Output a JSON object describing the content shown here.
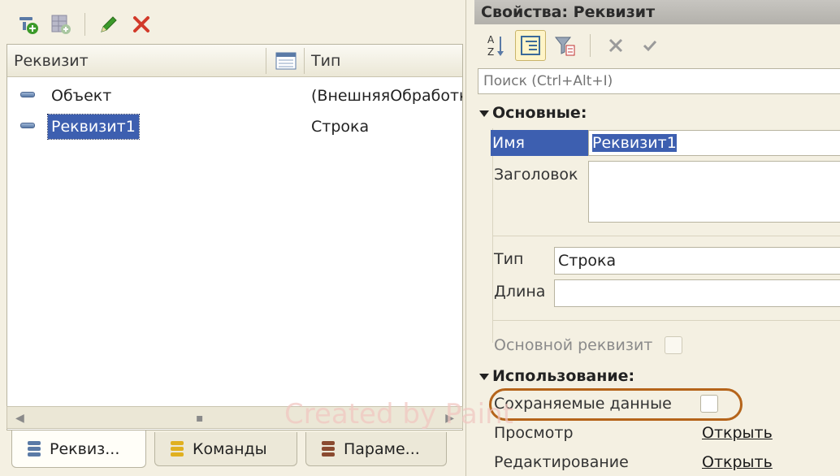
{
  "left": {
    "columns": {
      "name": "Реквизит",
      "type": "Тип"
    },
    "rows": [
      {
        "name": "Объект",
        "type": "(ВнешняяОбработка"
      },
      {
        "name": "Реквизит1",
        "type": "Строка"
      }
    ],
    "tabs": [
      {
        "label": "Реквиз..."
      },
      {
        "label": "Команды"
      },
      {
        "label": "Параме..."
      }
    ]
  },
  "right": {
    "title": "Свойства: Реквизит",
    "search_placeholder": "Поиск (Ctrl+Alt+I)",
    "sections": {
      "main": "Основные:",
      "usage": "Использование:"
    },
    "props": {
      "name_label": "Имя",
      "name_value": "Реквизит1",
      "title_label": "Заголовок",
      "type_label": "Тип",
      "type_value": "Строка",
      "length_label": "Длина",
      "main_attr_label": "Основной реквизит",
      "saved_data_label": "Сохраняемые данные",
      "view_label": "Просмотр",
      "view_link": "Открыть",
      "edit_label": "Редактирование",
      "edit_link": "Открыть"
    }
  },
  "watermark": "Created by Paint",
  "colors": {
    "selection": "#3d5fb0",
    "highlight_ring": "#b5641a",
    "delete_red": "#d23a2a",
    "pencil_green": "#3c9a2a"
  },
  "icons": [
    "add-attribute-icon",
    "add-table-icon",
    "edit-icon",
    "delete-icon",
    "sort-az-icon",
    "categories-icon",
    "filter-icon",
    "cancel-icon",
    "apply-icon",
    "attribute-icon",
    "column-settings-icon"
  ]
}
